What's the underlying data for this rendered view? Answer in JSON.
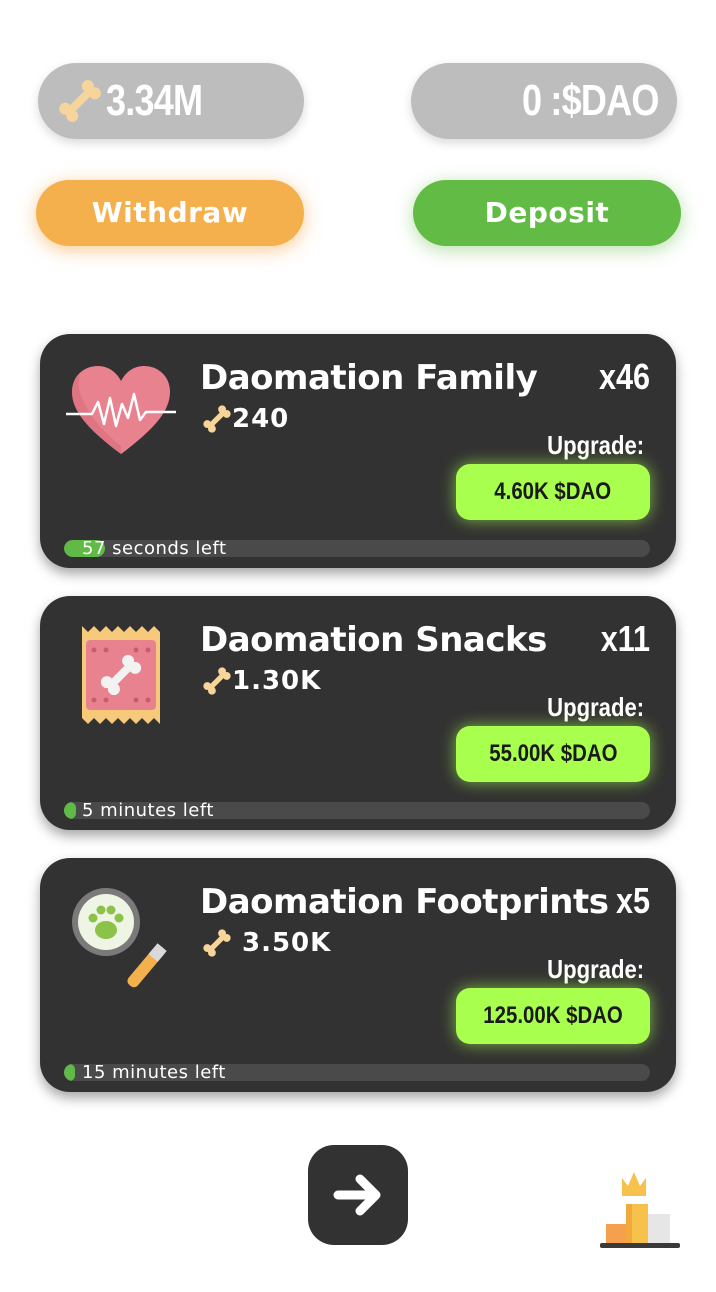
{
  "balances": {
    "bones": {
      "icon": "bone-icon",
      "value": "3.34M"
    },
    "dao": {
      "value": "0 :$DAO"
    }
  },
  "actions": {
    "withdraw_label": "Withdraw",
    "deposit_label": "Deposit"
  },
  "cards": [
    {
      "icon": "heart-pulse-icon",
      "title": "Daomation Family",
      "yield": "240",
      "count": "x46",
      "upgrade_label": "Upgrade:",
      "upgrade_price": "4.60K $DAO",
      "progress": 0.07,
      "progress_text": "57 seconds left"
    },
    {
      "icon": "snack-bag-icon",
      "title": "Daomation Snacks",
      "yield": "1.30K",
      "count": "x11",
      "upgrade_label": "Upgrade:",
      "upgrade_price": "55.00K $DAO",
      "progress": 0.02,
      "progress_text": "5 minutes left"
    },
    {
      "icon": "magnifier-paw-icon",
      "title": "Daomation Footprints",
      "yield": "3.50K",
      "count": "x5",
      "upgrade_label": "Upgrade:",
      "upgrade_price": "125.00K $DAO",
      "progress": 0.015,
      "progress_text": "15 minutes left"
    }
  ],
  "footer": {
    "next_icon": "arrow-right-icon",
    "leaderboard_icon": "leaderboard-podium-icon"
  },
  "colors": {
    "pill_bg": "#bdbdbd",
    "withdraw": "#f4b04c",
    "deposit": "#61bb44",
    "card_bg": "#323232",
    "upgrade_btn": "#a8ff4e",
    "progress_fill": "#5fbb46"
  }
}
